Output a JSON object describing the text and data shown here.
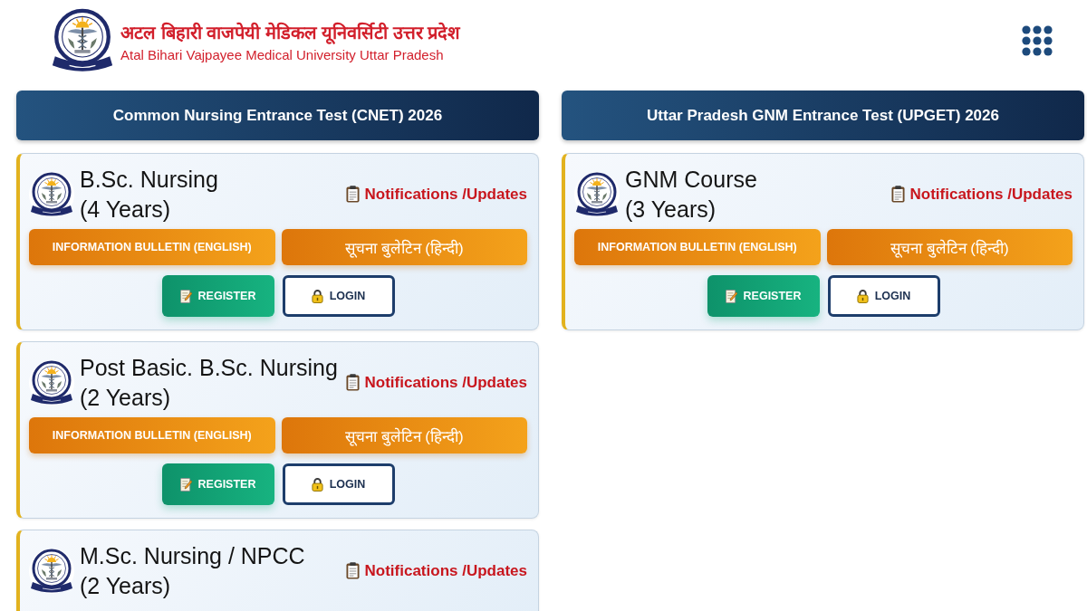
{
  "header": {
    "title_hindi": "अटल बिहारी वाजपेयी मेडिकल यूनिवर्सिटी उत्तर प्रदेश",
    "title_english": "Atal Bihari Vajpayee Medical University Uttar Pradesh"
  },
  "columns": [
    {
      "heading": "Common Nursing Entrance Test (CNET) 2026",
      "courses": [
        {
          "name": "B.Sc. Nursing",
          "duration": "(4 Years)",
          "notifications_link": "Notifications /Updates",
          "bulletin_english": "INFORMATION BULLETIN (ENGLISH)",
          "bulletin_hindi": "सूचना बुलेटिन (हिन्दी)",
          "register": "REGISTER",
          "login": "LOGIN"
        },
        {
          "name": "Post Basic. B.Sc. Nursing",
          "duration": "(2 Years)",
          "notifications_link": "Notifications /Updates",
          "bulletin_english": "INFORMATION BULLETIN (ENGLISH)",
          "bulletin_hindi": "सूचना बुलेटिन (हिन्दी)",
          "register": "REGISTER",
          "login": "LOGIN"
        },
        {
          "name": "M.Sc. Nursing / NPCC",
          "duration": "(2 Years)",
          "notifications_link": "Notifications /Updates"
        }
      ]
    },
    {
      "heading": "Uttar Pradesh GNM Entrance Test (UPGET) 2026",
      "courses": [
        {
          "name": "GNM Course",
          "duration": "(3 Years)",
          "notifications_link": "Notifications /Updates",
          "bulletin_english": "INFORMATION BULLETIN (ENGLISH)",
          "bulletin_hindi": "सूचना बुलेटिन (हिन्दी)",
          "register": "REGISTER",
          "login": "LOGIN"
        }
      ]
    }
  ]
}
